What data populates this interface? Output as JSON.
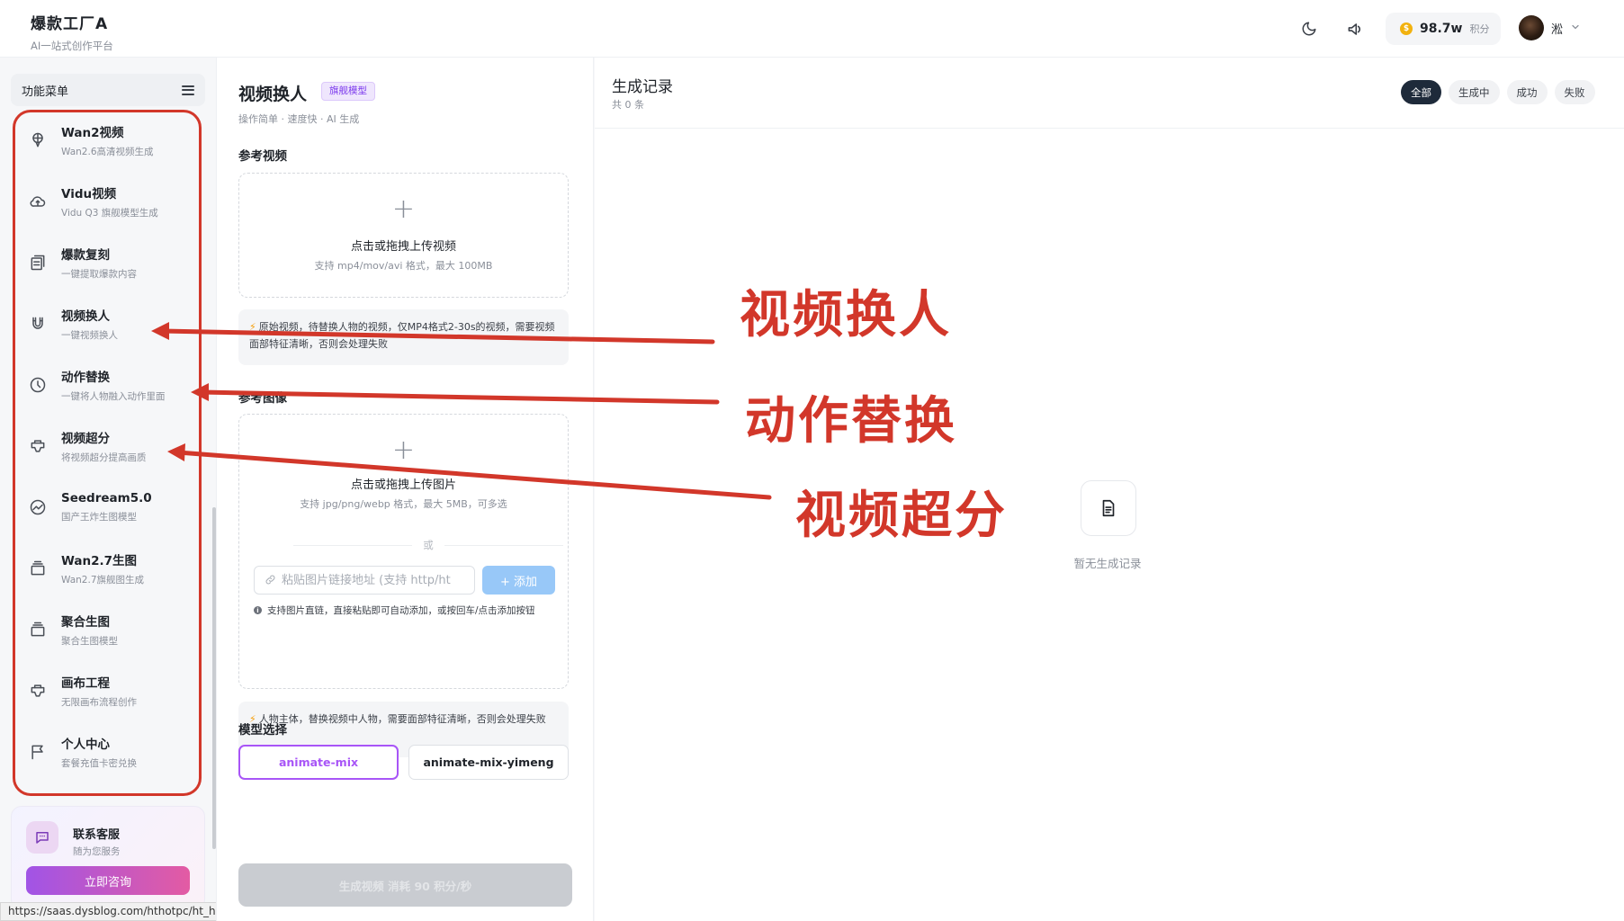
{
  "header": {
    "brand_title": "爆款工厂A",
    "brand_subtitle": "AI一站式创作平台",
    "icons": [
      "moon-icon",
      "megaphone-icon"
    ],
    "points_value": "98.7w",
    "points_unit": "积分",
    "coin_symbol": "$",
    "user_name": "淞"
  },
  "sidebar": {
    "menu_title": "功能菜单",
    "items": [
      {
        "title": "Wan2视频",
        "subtitle": "Wan2.6高清视频生成",
        "icon": "balloon-icon"
      },
      {
        "title": "Vidu视频",
        "subtitle": "Vidu Q3 旗舰模型生成",
        "icon": "cloud-icon"
      },
      {
        "title": "爆款复刻",
        "subtitle": "一键提取爆款内容",
        "icon": "copy-icon"
      },
      {
        "title": "视频换人",
        "subtitle": "一键视频换人",
        "icon": "magnet-icon"
      },
      {
        "title": "动作替换",
        "subtitle": "一键将人物融入动作里面",
        "icon": "clock-icon"
      },
      {
        "title": "视频超分",
        "subtitle": "将视频超分提高画质",
        "icon": "tag-icon"
      },
      {
        "title": "Seedream5.0",
        "subtitle": "国产王炸生图模型",
        "icon": "chart-icon"
      },
      {
        "title": "Wan2.7生图",
        "subtitle": "Wan2.7旗舰图生成",
        "icon": "layers-icon"
      },
      {
        "title": "聚合生图",
        "subtitle": "聚合生图模型",
        "icon": "layers-icon"
      },
      {
        "title": "画布工程",
        "subtitle": "无限画布流程创作",
        "icon": "tag-icon"
      },
      {
        "title": "个人中心",
        "subtitle": "套餐充值卡密兑换",
        "icon": "flag-icon"
      }
    ],
    "contact": {
      "title": "联系客服",
      "subtitle": "随为您服务",
      "button": "立即咨询"
    },
    "status_url": "https://saas.dysblog.com/hthotpc/ht_hot/create/animate-move"
  },
  "form": {
    "title": "视频换人",
    "badge": "旗舰模型",
    "subtitle": "操作简单 · 速度快 · AI 生成",
    "ref_video_label": "参考视频",
    "video_upload_text": "点击或拖拽上传视频",
    "video_upload_hint": "支持 mp4/mov/avi 格式，最大 100MB",
    "video_hint": "原始视频，待替换人物的视频，仅MP4格式2-30s的视频，需要视频面部特征清晰，否则会处理失败",
    "ref_image_label": "参考图像",
    "image_upload_text": "点击或拖拽上传图片",
    "image_upload_hint": "支持 jpg/png/webp 格式，最大 5MB，可多选",
    "or_text": "或",
    "url_placeholder": "粘贴图片链接地址 (支持 http/ht",
    "add_button": "+ 添加",
    "url_info": "支持图片直链，直接粘贴即可自动添加，或按回车/点击添加按钮",
    "image_hint": "人物主体，替换视频中人物，需要面部特征清晰，否则会处理失败",
    "model_label": "模型选择",
    "models": [
      "animate-mix",
      "animate-mix-yimeng"
    ],
    "selected_model": "animate-mix",
    "generate_button": "生成视频  消耗 90 积分/秒"
  },
  "records": {
    "title": "生成记录",
    "count": "共 0 条",
    "filters": [
      "全部",
      "生成中",
      "成功",
      "失败"
    ],
    "active_filter": "全部",
    "empty_text": "暂无生成记录"
  },
  "annotations": {
    "labels": [
      "视频换人",
      "动作替换",
      "视频超分"
    ],
    "color": "#d2372a"
  },
  "colors": {
    "accent_purple": "#a855f7",
    "annotation_red": "#d2372a",
    "active_filter_bg": "#1e2a3a",
    "add_button_blue": "#98c8f8"
  }
}
